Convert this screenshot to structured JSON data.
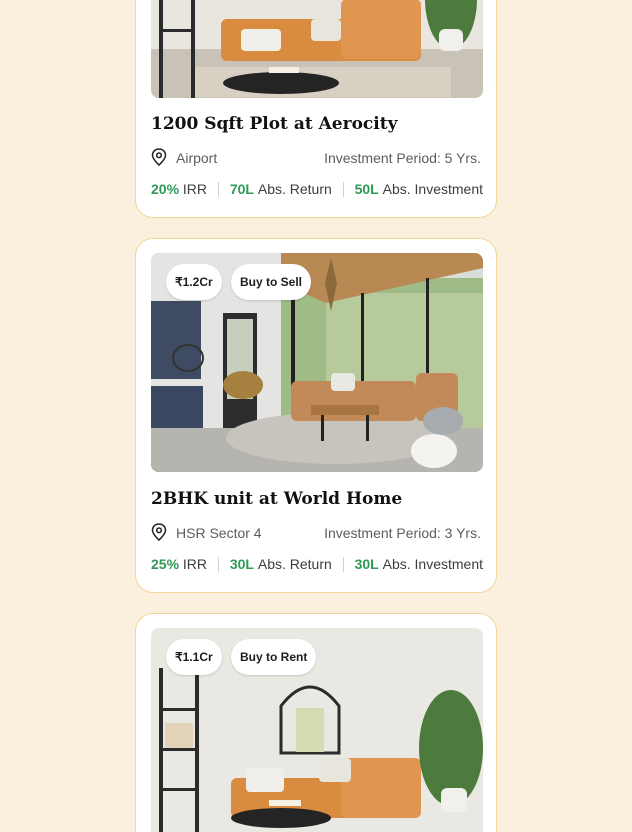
{
  "listings": [
    {
      "title": "1200 Sqft Plot at Aerocity",
      "location": "Airport",
      "period": "Investment Period: 5 Yrs.",
      "irr_value": "20%",
      "irr_label": "IRR",
      "return_value": "70L",
      "return_label": "Abs. Return",
      "investment_value": "50L",
      "investment_label": "Abs. Investment"
    },
    {
      "price": "₹1.2Cr",
      "tag": "Buy to Sell",
      "title": "2BHK unit at World Home",
      "location": "HSR Sector 4",
      "period": "Investment Period: 3 Yrs.",
      "irr_value": "25%",
      "irr_label": "IRR",
      "return_value": "30L",
      "return_label": "Abs. Return",
      "investment_value": "30L",
      "investment_label": "Abs. Investment"
    },
    {
      "price": "₹1.1Cr",
      "tag": "Buy to Rent"
    }
  ],
  "colors": {
    "background": "#fbf0dd",
    "card_border": "#f2d59a",
    "accent_green": "#2e9a56"
  },
  "icons": {
    "location": "location-pin-icon"
  }
}
